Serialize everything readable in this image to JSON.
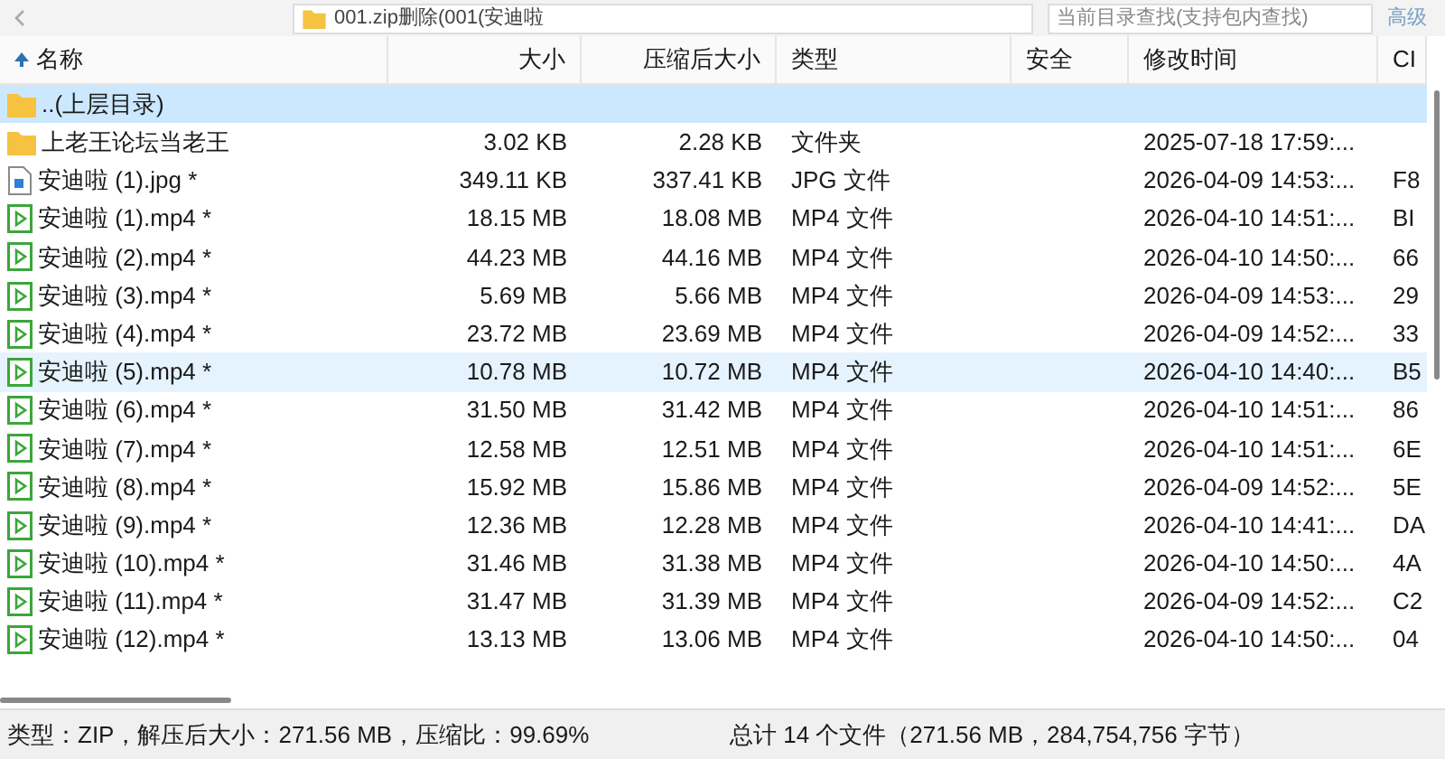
{
  "toolbar": {
    "address": "001.zip删除(001(安迪啦",
    "search": {
      "placeholder": "当前目录查找(支持包内查找)"
    },
    "advanced": "高级"
  },
  "table": {
    "columns": [
      {
        "label": "名称",
        "sorted": true
      },
      {
        "label": "大小",
        "sorted": false
      },
      {
        "label": "压缩后大小",
        "sorted": false
      },
      {
        "label": "类型",
        "sorted": false
      },
      {
        "label": "安全",
        "sorted": false
      },
      {
        "label": "修改时间",
        "sorted": false
      },
      {
        "label": "CI",
        "sorted": false
      }
    ],
    "rows": [
      {
        "kind": "parent",
        "name": "..(上层目录)",
        "selected": true,
        "hovered": false
      },
      {
        "kind": "folder",
        "name": "上老王论坛当老王",
        "size": "3.02 KB",
        "packed": "2.28 KB",
        "type": "文件夹",
        "modified": "2025-07-18 17:59:...",
        "selected": false,
        "hovered": false
      },
      {
        "kind": "image",
        "name": "安迪啦 (1).jpg *",
        "size": "349.11 KB",
        "packed": "337.41 KB",
        "type": "JPG 文件",
        "modified": "2026-04-09 14:53:...",
        "crc": "F8",
        "selected": false,
        "hovered": false
      },
      {
        "kind": "video",
        "name": "安迪啦 (1).mp4 *",
        "size": "18.15 MB",
        "packed": "18.08 MB",
        "type": "MP4 文件",
        "modified": "2026-04-10 14:51:...",
        "crc": "BI",
        "selected": false,
        "hovered": false
      },
      {
        "kind": "video",
        "name": "安迪啦 (2).mp4 *",
        "size": "44.23 MB",
        "packed": "44.16 MB",
        "type": "MP4 文件",
        "modified": "2026-04-10 14:50:...",
        "crc": "66",
        "selected": false,
        "hovered": false
      },
      {
        "kind": "video",
        "name": "安迪啦 (3).mp4 *",
        "size": "5.69 MB",
        "packed": "5.66 MB",
        "type": "MP4 文件",
        "modified": "2026-04-09 14:53:...",
        "crc": "29",
        "selected": false,
        "hovered": false
      },
      {
        "kind": "video",
        "name": "安迪啦 (4).mp4 *",
        "size": "23.72 MB",
        "packed": "23.69 MB",
        "type": "MP4 文件",
        "modified": "2026-04-09 14:52:...",
        "crc": "33",
        "selected": false,
        "hovered": false
      },
      {
        "kind": "video",
        "name": "安迪啦 (5).mp4 *",
        "size": "10.78 MB",
        "packed": "10.72 MB",
        "type": "MP4 文件",
        "modified": "2026-04-10 14:40:...",
        "crc": "B5",
        "selected": false,
        "hovered": true
      },
      {
        "kind": "video",
        "name": "安迪啦 (6).mp4 *",
        "size": "31.50 MB",
        "packed": "31.42 MB",
        "type": "MP4 文件",
        "modified": "2026-04-10 14:51:...",
        "crc": "86",
        "selected": false,
        "hovered": false
      },
      {
        "kind": "video",
        "name": "安迪啦 (7).mp4 *",
        "size": "12.58 MB",
        "packed": "12.51 MB",
        "type": "MP4 文件",
        "modified": "2026-04-10 14:51:...",
        "crc": "6E",
        "selected": false,
        "hovered": false
      },
      {
        "kind": "video",
        "name": "安迪啦 (8).mp4 *",
        "size": "15.92 MB",
        "packed": "15.86 MB",
        "type": "MP4 文件",
        "modified": "2026-04-09 14:52:...",
        "crc": "5E",
        "selected": false,
        "hovered": false
      },
      {
        "kind": "video",
        "name": "安迪啦 (9).mp4 *",
        "size": "12.36 MB",
        "packed": "12.28 MB",
        "type": "MP4 文件",
        "modified": "2026-04-10 14:41:...",
        "crc": "DA",
        "selected": false,
        "hovered": false
      },
      {
        "kind": "video",
        "name": "安迪啦 (10).mp4 *",
        "size": "31.46 MB",
        "packed": "31.38 MB",
        "type": "MP4 文件",
        "modified": "2026-04-10 14:50:...",
        "crc": "4A",
        "selected": false,
        "hovered": false
      },
      {
        "kind": "video",
        "name": "安迪啦 (11).mp4 *",
        "size": "31.47 MB",
        "packed": "31.39 MB",
        "type": "MP4 文件",
        "modified": "2026-04-09 14:52:...",
        "crc": "C2",
        "selected": false,
        "hovered": false
      },
      {
        "kind": "video",
        "name": "安迪啦 (12).mp4 *",
        "size": "13.13 MB",
        "packed": "13.06 MB",
        "type": "MP4 文件",
        "modified": "2026-04-10 14:50:...",
        "crc": "04",
        "selected": false,
        "hovered": false
      }
    ]
  },
  "status_bar": {
    "left": "类型：ZIP，解压后大小：271.56 MB，压缩比：99.69%",
    "right": "总计 14 个文件（271.56 MB，284,754,756 字节）"
  }
}
